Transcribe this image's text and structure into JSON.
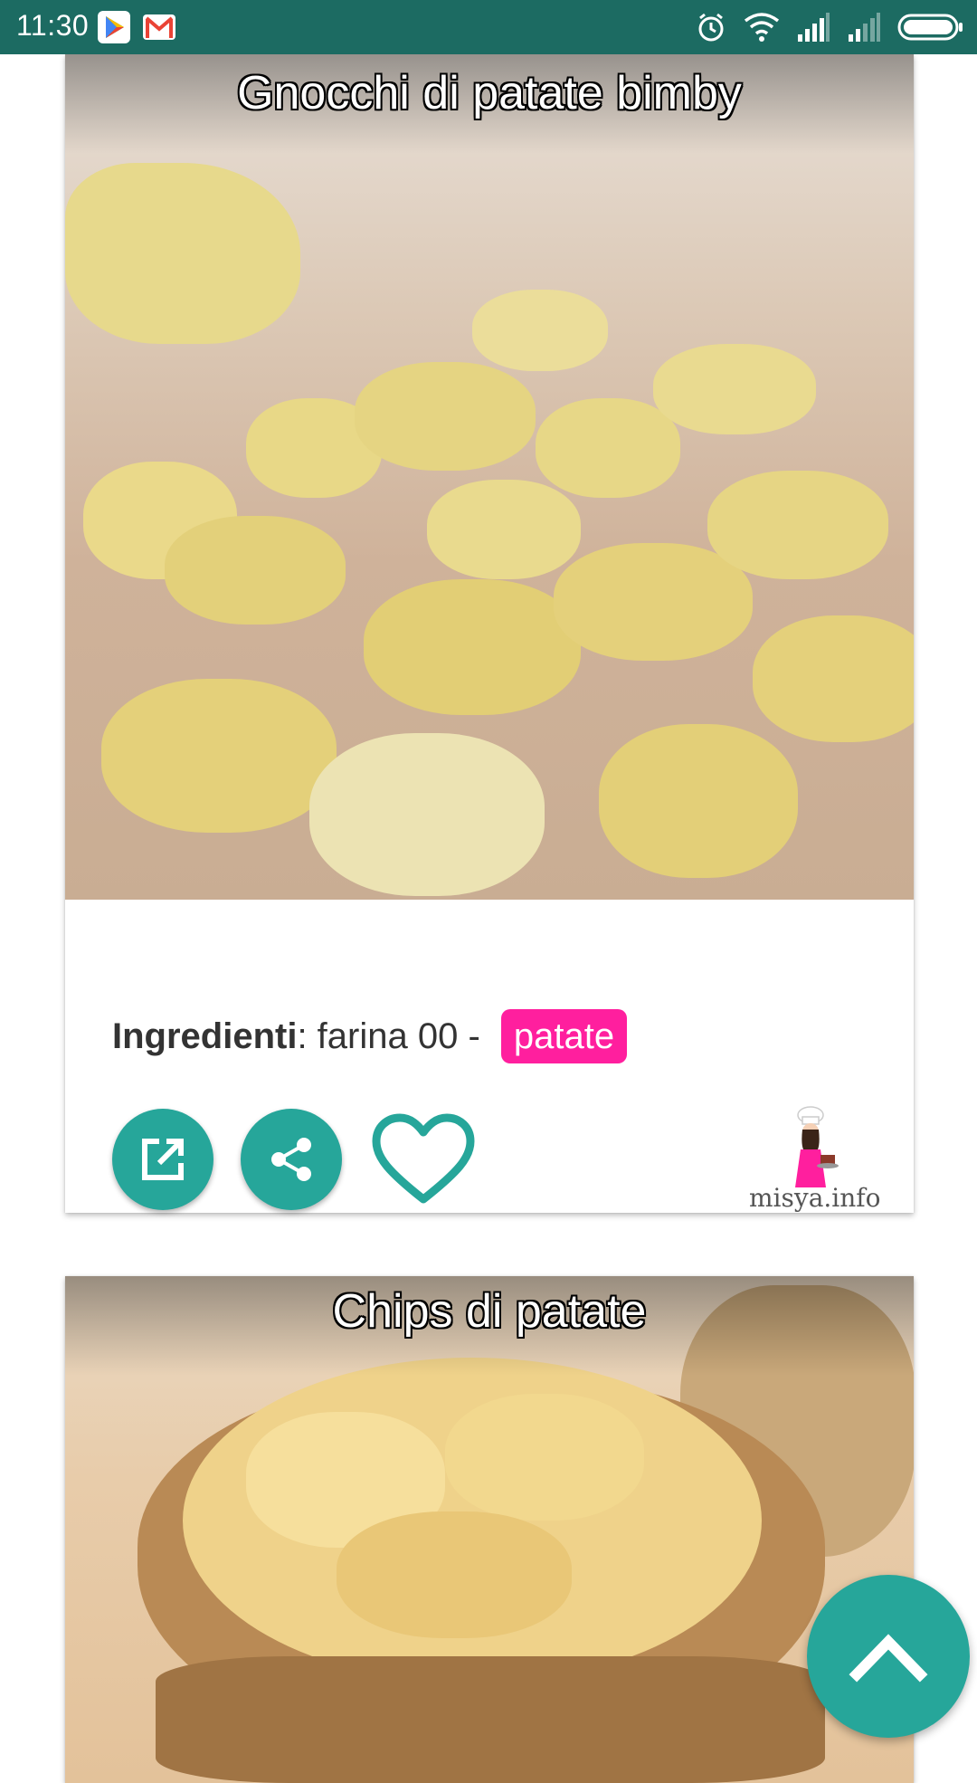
{
  "status_bar": {
    "time": "11:30",
    "icons": [
      "play-store-icon",
      "gmail-icon",
      "alarm-icon",
      "wifi-icon",
      "signal-icon",
      "signal-icon",
      "battery-icon"
    ]
  },
  "cards": [
    {
      "title": "Gnocchi di patate bimby",
      "ingredients_label": "Ingredienti",
      "ingredients_text": ": farina 00 - ",
      "ingredient_tag": "patate",
      "brand": "misya.info",
      "actions": [
        "open-external-icon",
        "share-icon",
        "heart-icon"
      ]
    },
    {
      "title": "Chips di patate"
    }
  ],
  "colors": {
    "status_bar": "#1c6b62",
    "accent": "#26a69a",
    "tag": "#ff1f9e"
  },
  "scroll_up_icon": "chevron-up-icon"
}
